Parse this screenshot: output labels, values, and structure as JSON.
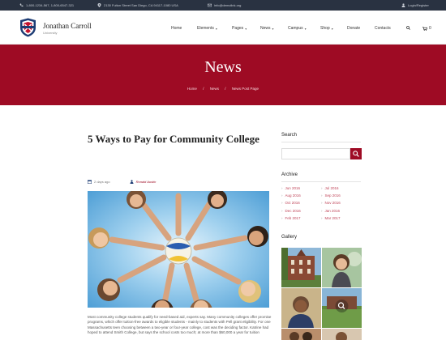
{
  "topbar": {
    "phones": "1-800-1234-567, 1-800-6547-321",
    "address": "2130 Fulton Street San Diego, CA 94117-1080 USA",
    "email": "info@demolink.org",
    "account": "Login/Register"
  },
  "brand": {
    "name": "Jonathan Carroll",
    "sub": "University"
  },
  "nav": {
    "home": "Home",
    "elements": "Elements",
    "pages": "Pages",
    "news": "News",
    "campus": "Campus",
    "shop": "Shop",
    "donate": "Donate",
    "contacts": "Contacts",
    "cart_count": "0"
  },
  "hero": {
    "title": "News",
    "crumbs": {
      "home": "Home",
      "sep": "/",
      "news": "News",
      "current": "News Post Page"
    }
  },
  "post": {
    "title": "5 Ways to Pay for Community College",
    "date": "2 days ago",
    "author": "Ronald Austin",
    "excerpt": "Most community college students qualify for need-based aid, experts say. Many community colleges offer promise programs, which offer tuition-free awards to eligible students - mainly to students with Pell grant eligibility. For one Massachusetts teen choosing between a two-year or four-year college, cost was the deciding factor. Katrine had hoped to attend Smith College, but says the school costs too much; at more than $60,000 a year for tuition"
  },
  "sidebar": {
    "search_title": "Search",
    "archive_title": "Archive",
    "archive": [
      "Jun 2016",
      "Jul 2016",
      "Aug 2016",
      "Sep 2016",
      "Oct 2016",
      "Nov 2016",
      "Dec 2016",
      "Jan 2016",
      "Feb 2017",
      "Mar 2017"
    ],
    "gallery_title": "Gallery"
  },
  "colors": {
    "accent": "#9e0b24",
    "topbar": "#293241"
  },
  "icons": [
    "phone-icon",
    "location-icon",
    "mail-icon",
    "user-icon",
    "search-icon",
    "cart-icon",
    "calendar-icon",
    "author-icon",
    "zoom-icon"
  ]
}
